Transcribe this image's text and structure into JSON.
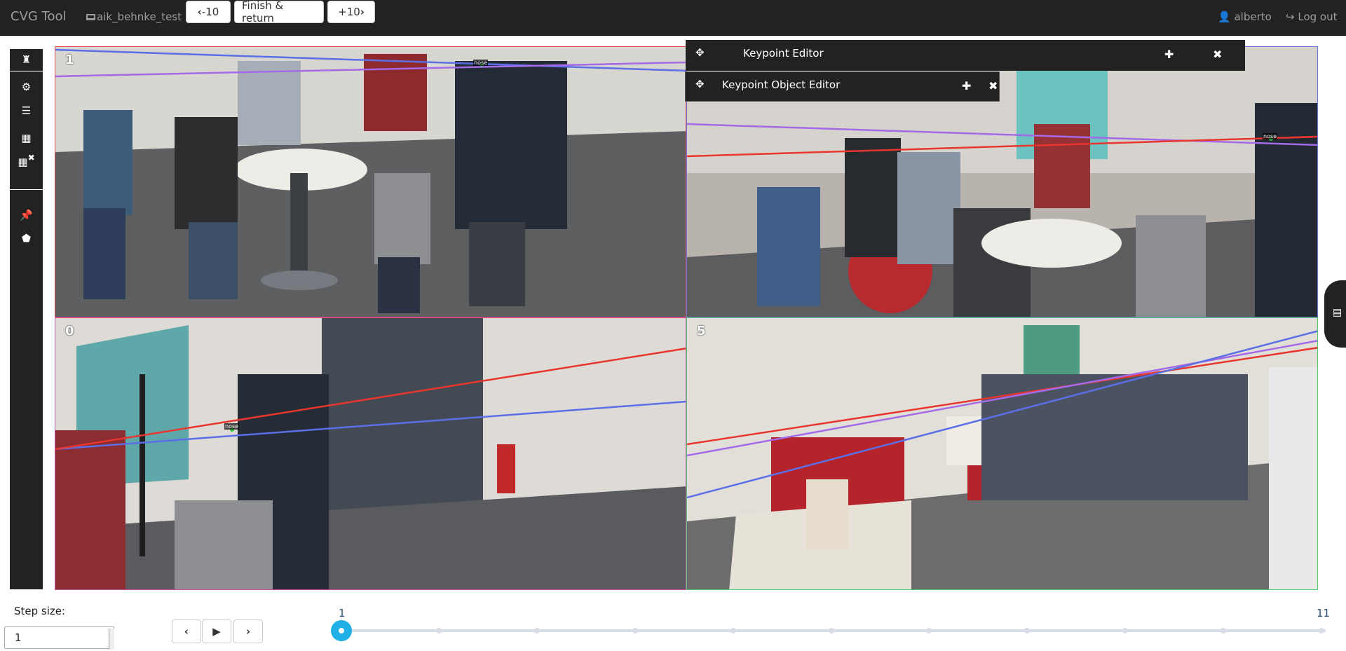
{
  "navbar": {
    "brand": "CVG Tool",
    "task_name": "aik_behnke_test",
    "prev_label": "-10",
    "finish_label": "Finish & return",
    "next_label": "+10",
    "user": "alberto",
    "logout": "Log out"
  },
  "views": [
    {
      "label": "1",
      "border_color": "#e8474f",
      "keypoint_label": "nose"
    },
    {
      "label": "",
      "border_color": "#6a7bd6",
      "keypoint_label": "nose"
    },
    {
      "label": "0",
      "border_color": "#c354a8",
      "keypoint_label": "nose"
    },
    {
      "label": "5",
      "border_color": "#57c86c"
    }
  ],
  "line_colors": {
    "red": "#e8362f",
    "blue": "#5b6fe6",
    "purple": "#a46ae8"
  },
  "panels": {
    "keypoint_editor": {
      "title": "Keypoint Editor"
    },
    "keypoint_object_editor": {
      "title": "Keypoint Object Editor"
    }
  },
  "player": {
    "step_size_label": "Step size:",
    "step_size_value": "1",
    "slider_min": "1",
    "slider_max": "11",
    "current_frame": 1
  }
}
